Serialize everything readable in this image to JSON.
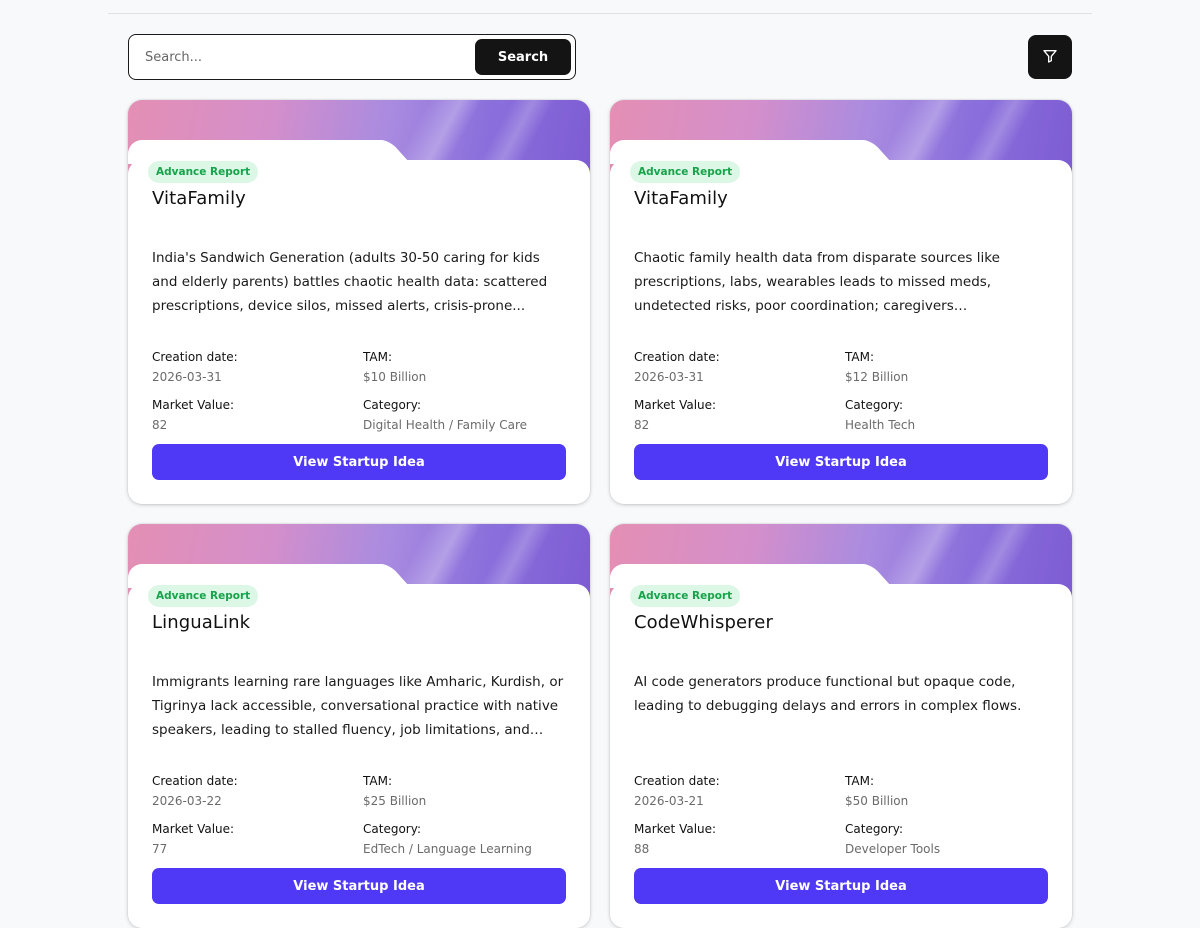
{
  "search": {
    "placeholder": "Search...",
    "button_label": "Search"
  },
  "filter": {
    "icon": "filter-icon"
  },
  "colors": {
    "primary_button": "#4f39f6",
    "dark_button": "#141414",
    "badge_bg": "#dcf7e6",
    "badge_text": "#16a34a"
  },
  "labels": {
    "creation_date": "Creation date:",
    "tam": "TAM:",
    "market_value": "Market Value:",
    "category": "Category:"
  },
  "cards": [
    {
      "badge": "Advance Report",
      "title": "VitaFamily",
      "description": "India's Sandwich Generation (adults 30-50 caring for kids and elderly parents) battles chaotic health data: scattered prescriptions, device silos, missed alerts, crisis-prone...",
      "creation_date": "2026-03-31",
      "tam": "$10 Billion",
      "market_value": "82",
      "category": "Digital Health / Family Care",
      "button_label": "View Startup Idea"
    },
    {
      "badge": "Advance Report",
      "title": "VitaFamily",
      "description": "Chaotic family health data from disparate sources like prescriptions, labs, wearables leads to missed meds, undetected risks, poor coordination; caregivers overwhelmed...",
      "creation_date": "2026-03-31",
      "tam": "$12 Billion",
      "market_value": "82",
      "category": "Health Tech",
      "button_label": "View Startup Idea"
    },
    {
      "badge": "Advance Report",
      "title": "LinguaLink",
      "description": "Immigrants learning rare languages like Amharic, Kurdish, or Tigrinya lack accessible, conversational practice with native speakers, leading to stalled fluency, job limitations, and socia...",
      "creation_date": "2026-03-22",
      "tam": "$25 Billion",
      "market_value": "77",
      "category": "EdTech / Language Learning",
      "button_label": "View Startup Idea"
    },
    {
      "badge": "Advance Report",
      "title": "CodeWhisperer",
      "description": "AI code generators produce functional but opaque code, leading to debugging delays and errors in complex flows.",
      "creation_date": "2026-03-21",
      "tam": "$50 Billion",
      "market_value": "88",
      "category": "Developer Tools",
      "button_label": "View Startup Idea"
    }
  ]
}
